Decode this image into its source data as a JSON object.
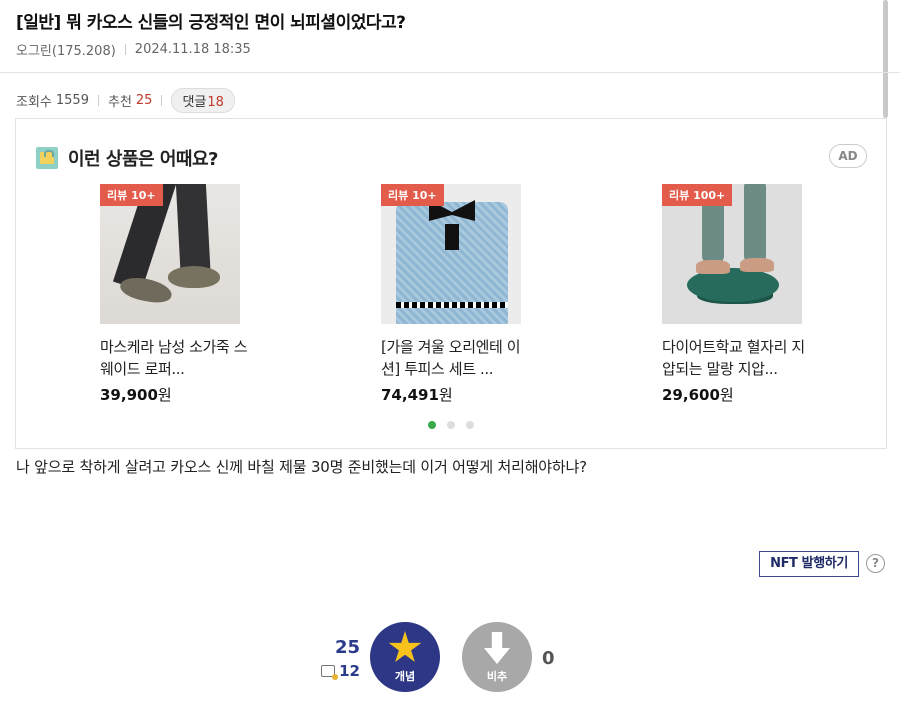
{
  "post": {
    "title": "[일반] 뭐 카오스 신들의 긍정적인 면이 뇌피셜이었다고?",
    "author": "오그린(175.208)",
    "datetime": "2024.11.18 18:35",
    "views_label": "조회수",
    "views": "1559",
    "recommend_label": "추천",
    "recommend": "25",
    "comments_label": "댓글",
    "comments": "18",
    "body": "나 앞으로 착하게 살려고 카오스 신께 바칠 제물 30명 준비했는데 이거 어떻게 처리해야하냐?"
  },
  "ad": {
    "title": "이런 상품은 어때요?",
    "badge": "AD",
    "products": [
      {
        "tag": "리뷰 10+",
        "name": "마스케라 남성 소가죽 스웨이드 로퍼...",
        "price": "39,900",
        "unit": "원"
      },
      {
        "tag": "리뷰 10+",
        "name": "[가을 겨울 오리엔테 이션] 투피스 세트 ...",
        "price": "74,491",
        "unit": "원"
      },
      {
        "tag": "리뷰 100+",
        "name": "다이어트학교 혈자리 지압되는 말랑 지압...",
        "price": "29,600",
        "unit": "원"
      }
    ],
    "carousel_pages": 3,
    "carousel_active": 1
  },
  "actions": {
    "nft_label": "NFT 발행하기",
    "help_label": "?",
    "upvote_label": "개념",
    "downvote_label": "비추",
    "upvote_count": "25",
    "fixed_count": "12",
    "downvote_count": "0"
  },
  "colors": {
    "upvote": "#2d3785",
    "downvote": "#a8a8a8",
    "accent_red": "#c0392b",
    "review_tag": "#e35b4a",
    "carousel_active": "#3aa84c"
  },
  "icons": {
    "ad_icon": "shopping-bag-icon",
    "upvote_icon": "star-icon",
    "downvote_icon": "down-arrow-icon",
    "fixed_icon": "fixed-post-icon",
    "help_icon": "question-circle-icon"
  }
}
